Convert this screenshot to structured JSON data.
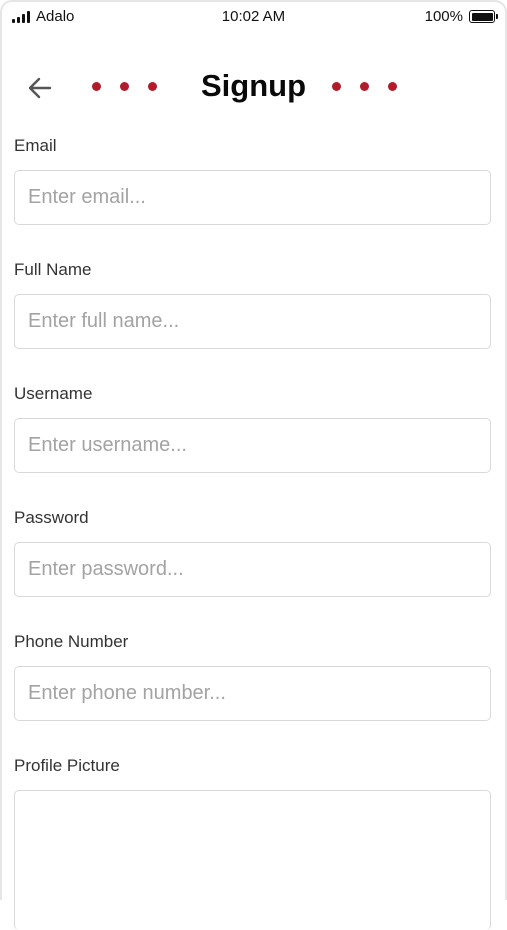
{
  "status_bar": {
    "carrier": "Adalo",
    "time": "10:02 AM",
    "battery": "100%",
    "battery_level": 1.0
  },
  "header": {
    "title": "Signup",
    "back_icon": "arrow-left-icon",
    "accent_color": "#b01c2a"
  },
  "form": {
    "email": {
      "label": "Email",
      "placeholder": "Enter email..."
    },
    "full_name": {
      "label": "Full Name",
      "placeholder": "Enter full name..."
    },
    "username": {
      "label": "Username",
      "placeholder": "Enter username..."
    },
    "password": {
      "label": "Password",
      "placeholder": "Enter password..."
    },
    "phone": {
      "label": "Phone Number",
      "placeholder": "Enter phone number..."
    },
    "profile_picture": {
      "label": "Profile Picture"
    }
  }
}
